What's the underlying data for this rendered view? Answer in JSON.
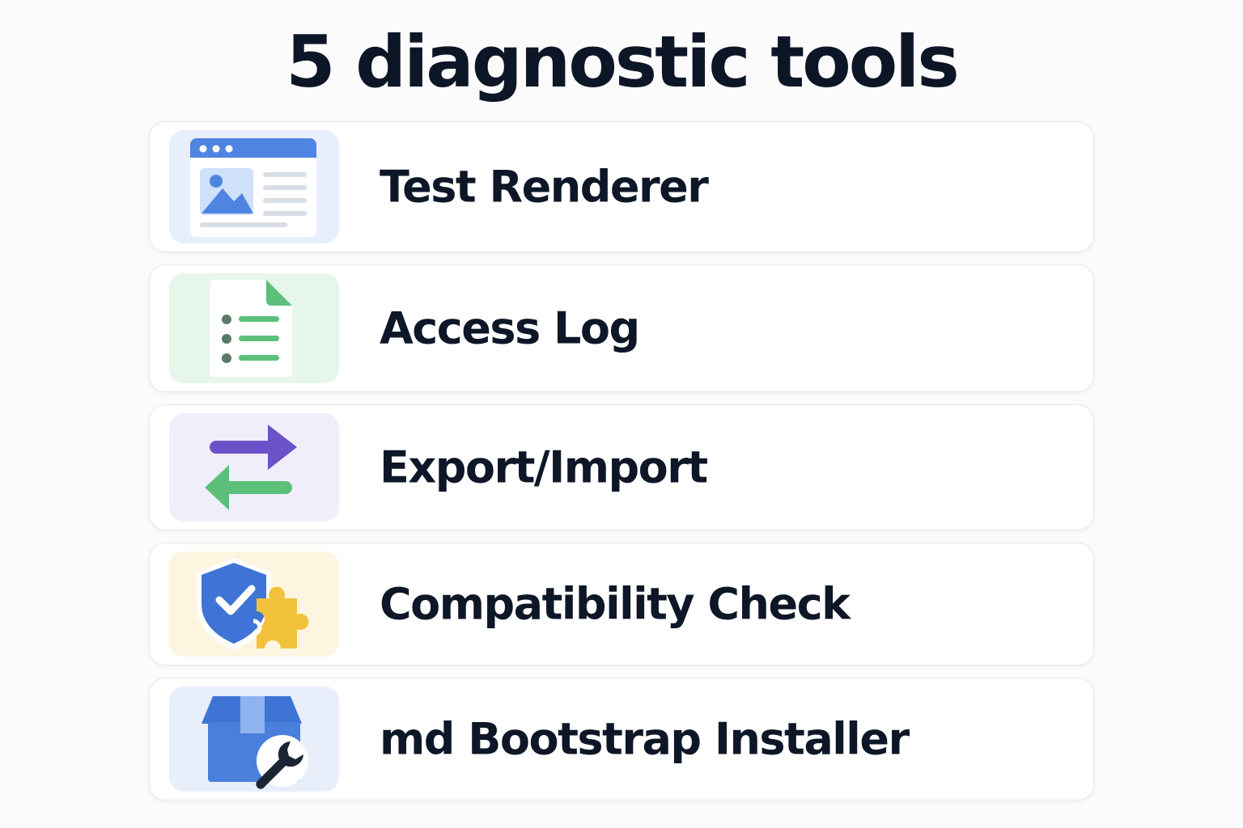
{
  "title": "5 diagnostic tools",
  "tools": [
    {
      "label": "Test Renderer",
      "icon": "browser-window-image-icon",
      "color": "#4a7fdc"
    },
    {
      "label": "Access Log",
      "icon": "log-document-icon",
      "color": "#5cc07a"
    },
    {
      "label": "Export/Import",
      "icon": "swap-arrows-icon",
      "color": "#6b52c8"
    },
    {
      "label": "Compatibility Check",
      "icon": "shield-puzzle-icon",
      "color": "#f2c23c"
    },
    {
      "label": "md Bootstrap Installer",
      "icon": "box-wrench-icon",
      "color": "#4a7fdc"
    }
  ]
}
